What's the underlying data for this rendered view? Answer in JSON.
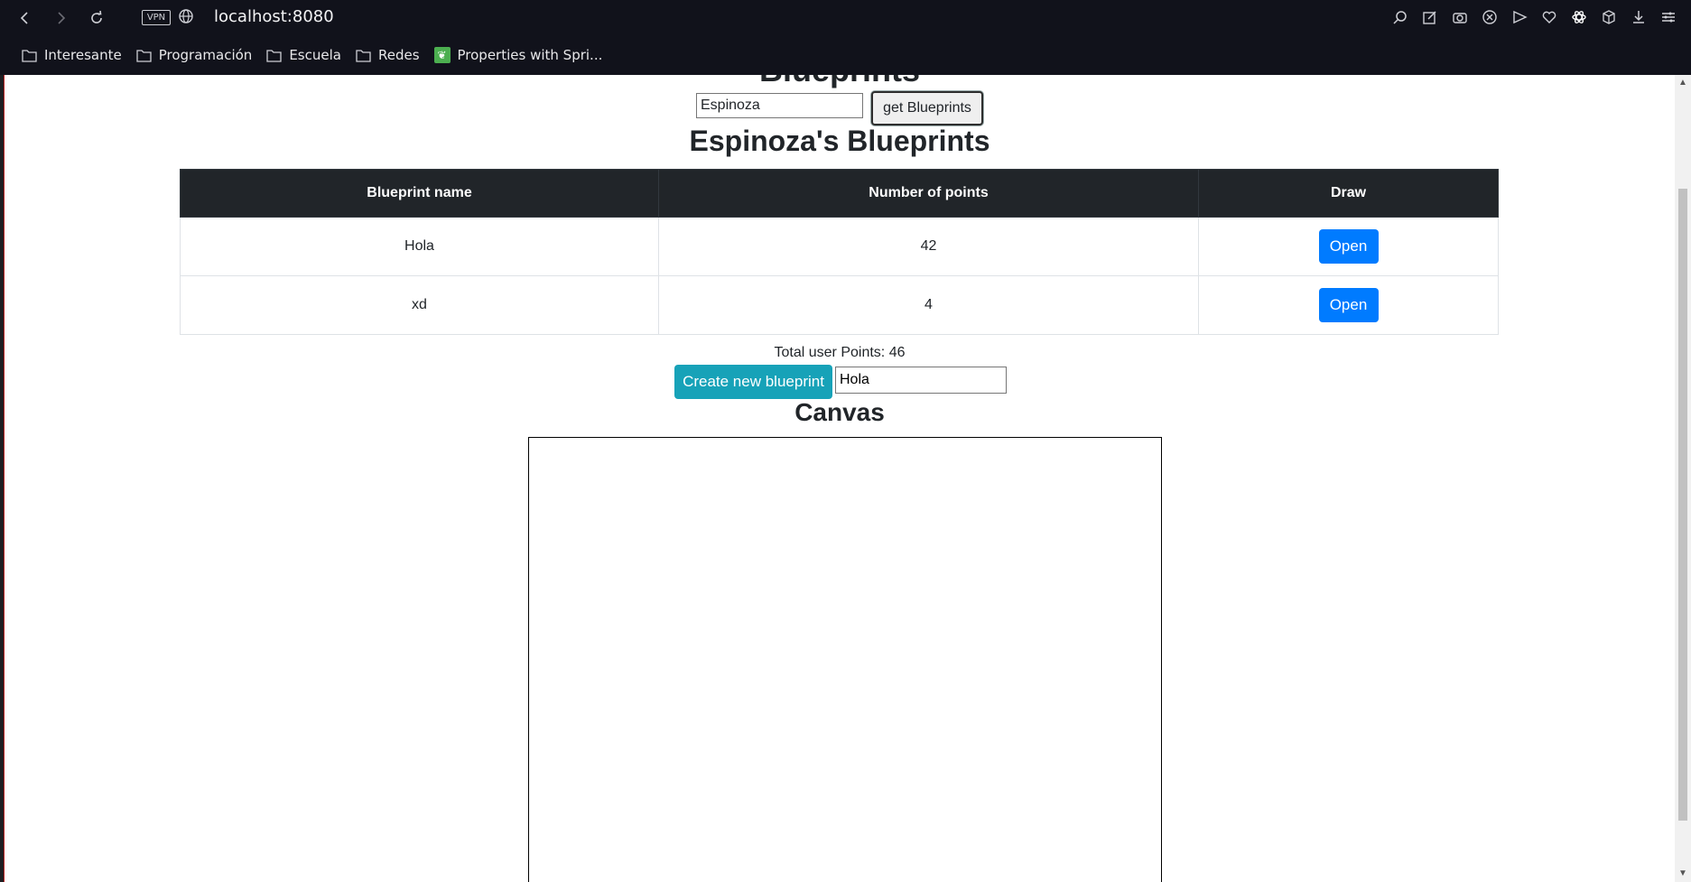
{
  "browser": {
    "url": "localhost:8080",
    "vpn_label": "VPN",
    "bookmarks": [
      {
        "label": "Interesante"
      },
      {
        "label": "Programación"
      },
      {
        "label": "Escuela"
      },
      {
        "label": "Redes"
      },
      {
        "label": "Properties with Spri..."
      }
    ]
  },
  "page": {
    "main_heading": "Blueprints",
    "author_input_value": "Espinoza",
    "get_button_label": "get Blueprints",
    "table_title": "Espinoza's Blueprints",
    "table": {
      "headers": [
        "Blueprint name",
        "Number of points",
        "Draw"
      ],
      "rows": [
        {
          "name": "Hola",
          "points": "42",
          "action": "Open"
        },
        {
          "name": "xd",
          "points": "4",
          "action": "Open"
        }
      ]
    },
    "total_points_text": "Total user Points: 46",
    "create_button_label": "Create new blueprint",
    "blueprint_input_value": "Hola",
    "canvas_title": "Canvas"
  },
  "colors": {
    "primary": "#007bff",
    "info": "#17a2b8",
    "table_header": "#212529",
    "chrome_bg": "#11121b"
  }
}
